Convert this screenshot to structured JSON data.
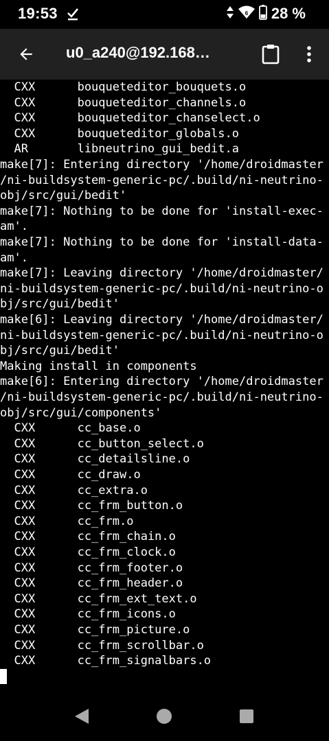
{
  "status_bar": {
    "time": "19:53",
    "battery_percent": "28 %",
    "icons": [
      "download-done-icon",
      "data-arrows-icon",
      "wifi-6-icon",
      "battery-icon"
    ]
  },
  "toolbar": {
    "title": "u0_a240@192.168…",
    "icons": [
      "back-arrow-icon",
      "clipboard-icon",
      "more-vert-icon"
    ]
  },
  "terminal": {
    "lines": [
      "  CXX      bouqueteditor_bouquets.o",
      "  CXX      bouqueteditor_channels.o",
      "  CXX      bouqueteditor_chanselect.o",
      "  CXX      bouqueteditor_globals.o",
      "  AR       libneutrino_gui_bedit.a",
      "make[7]: Entering directory '/home/droidmaster",
      "/ni-buildsystem-generic-pc/.build/ni-neutrino-",
      "obj/src/gui/bedit'",
      "make[7]: Nothing to be done for 'install-exec-",
      "am'.",
      "make[7]: Nothing to be done for 'install-data-",
      "am'.",
      "make[7]: Leaving directory '/home/droidmaster/",
      "ni-buildsystem-generic-pc/.build/ni-neutrino-o",
      "bj/src/gui/bedit'",
      "make[6]: Leaving directory '/home/droidmaster/",
      "ni-buildsystem-generic-pc/.build/ni-neutrino-o",
      "bj/src/gui/bedit'",
      "Making install in components",
      "make[6]: Entering directory '/home/droidmaster",
      "/ni-buildsystem-generic-pc/.build/ni-neutrino-",
      "obj/src/gui/components'",
      "  CXX      cc_base.o",
      "  CXX      cc_button_select.o",
      "  CXX      cc_detailsline.o",
      "  CXX      cc_draw.o",
      "  CXX      cc_extra.o",
      "  CXX      cc_frm_button.o",
      "  CXX      cc_frm.o",
      "  CXX      cc_frm_chain.o",
      "  CXX      cc_frm_clock.o",
      "  CXX      cc_frm_footer.o",
      "  CXX      cc_frm_header.o",
      "  CXX      cc_frm_ext_text.o",
      "  CXX      cc_frm_icons.o",
      "  CXX      cc_frm_picture.o",
      "  CXX      cc_frm_scrollbar.o",
      "  CXX      cc_frm_signalbars.o"
    ]
  },
  "navbar": {
    "icons": [
      "back-triangle-icon",
      "home-circle-icon",
      "recents-square-icon"
    ]
  }
}
